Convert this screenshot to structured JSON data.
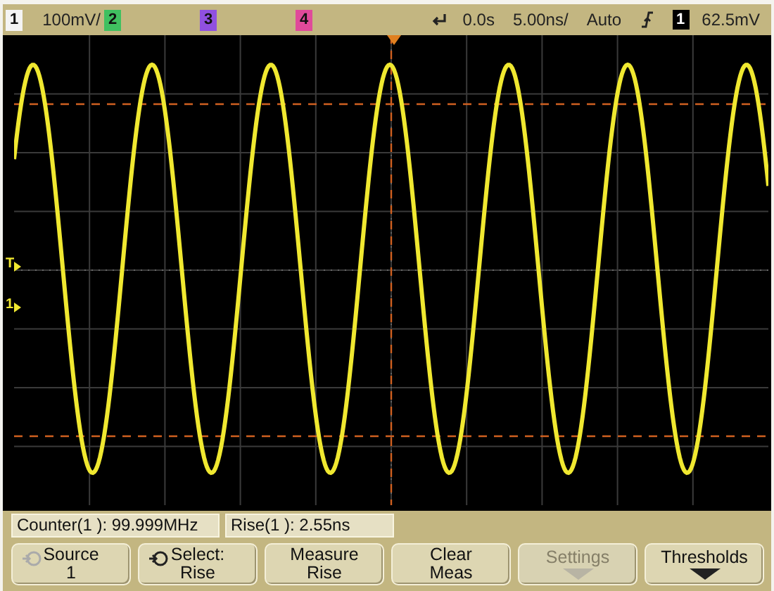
{
  "top_bar": {
    "channels": [
      {
        "label": "1",
        "color": "#f4f4f4",
        "scale": "100mV/"
      },
      {
        "label": "2",
        "color": "#40c060"
      },
      {
        "label": "3",
        "color": "#9050e0"
      },
      {
        "label": "4",
        "color": "#e04a9a"
      }
    ],
    "time_ref": "0.0s",
    "time_scale": "5.00ns/",
    "trigger_mode": "Auto",
    "trigger_source": "1",
    "trigger_level": "62.5mV"
  },
  "screen": {
    "markers": [
      {
        "label": "T"
      },
      {
        "label": "1"
      }
    ]
  },
  "measurements": [
    "Counter(1 ): 99.999MHz",
    "Rise(1 ): 2.55ns"
  ],
  "softkeys": [
    {
      "lines": [
        "Source",
        "1"
      ],
      "kind": "knob",
      "icon_active": false,
      "disabled": false
    },
    {
      "lines": [
        "Select:",
        "Rise"
      ],
      "kind": "knob",
      "icon_active": true,
      "disabled": false
    },
    {
      "lines": [
        "Measure",
        "Rise"
      ],
      "disabled": false
    },
    {
      "lines": [
        "Clear",
        "Meas"
      ],
      "disabled": false
    },
    {
      "lines": [
        "Settings"
      ],
      "arrow": true,
      "disabled": true
    },
    {
      "lines": [
        "Thresholds"
      ],
      "arrow": true,
      "disabled": false
    }
  ]
}
